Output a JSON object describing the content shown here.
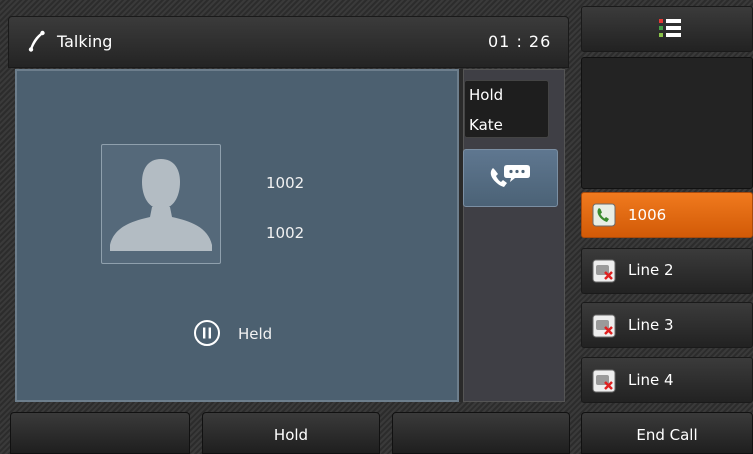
{
  "status_bar": {
    "state": "Talking",
    "timer": "01 : 26"
  },
  "call": {
    "number": "1002",
    "name": "1002",
    "state": "Held"
  },
  "hold_list": {
    "title": "Hold",
    "name": "Kate"
  },
  "line_keys": [
    {
      "label": "1006",
      "active": true,
      "icon": "handset-active-icon"
    },
    {
      "label": "Line 2",
      "active": false,
      "icon": "line-disconnected-icon"
    },
    {
      "label": "Line 3",
      "active": false,
      "icon": "line-disconnected-icon"
    },
    {
      "label": "Line 4",
      "active": false,
      "icon": "line-disconnected-icon"
    }
  ],
  "softkeys": [
    "",
    "Hold",
    "",
    "End Call"
  ],
  "colors": {
    "accent": "#e8680f",
    "panel": "#4c6070",
    "menu_dots": [
      "#e53935",
      "#43a047",
      "#8bc34a"
    ]
  }
}
